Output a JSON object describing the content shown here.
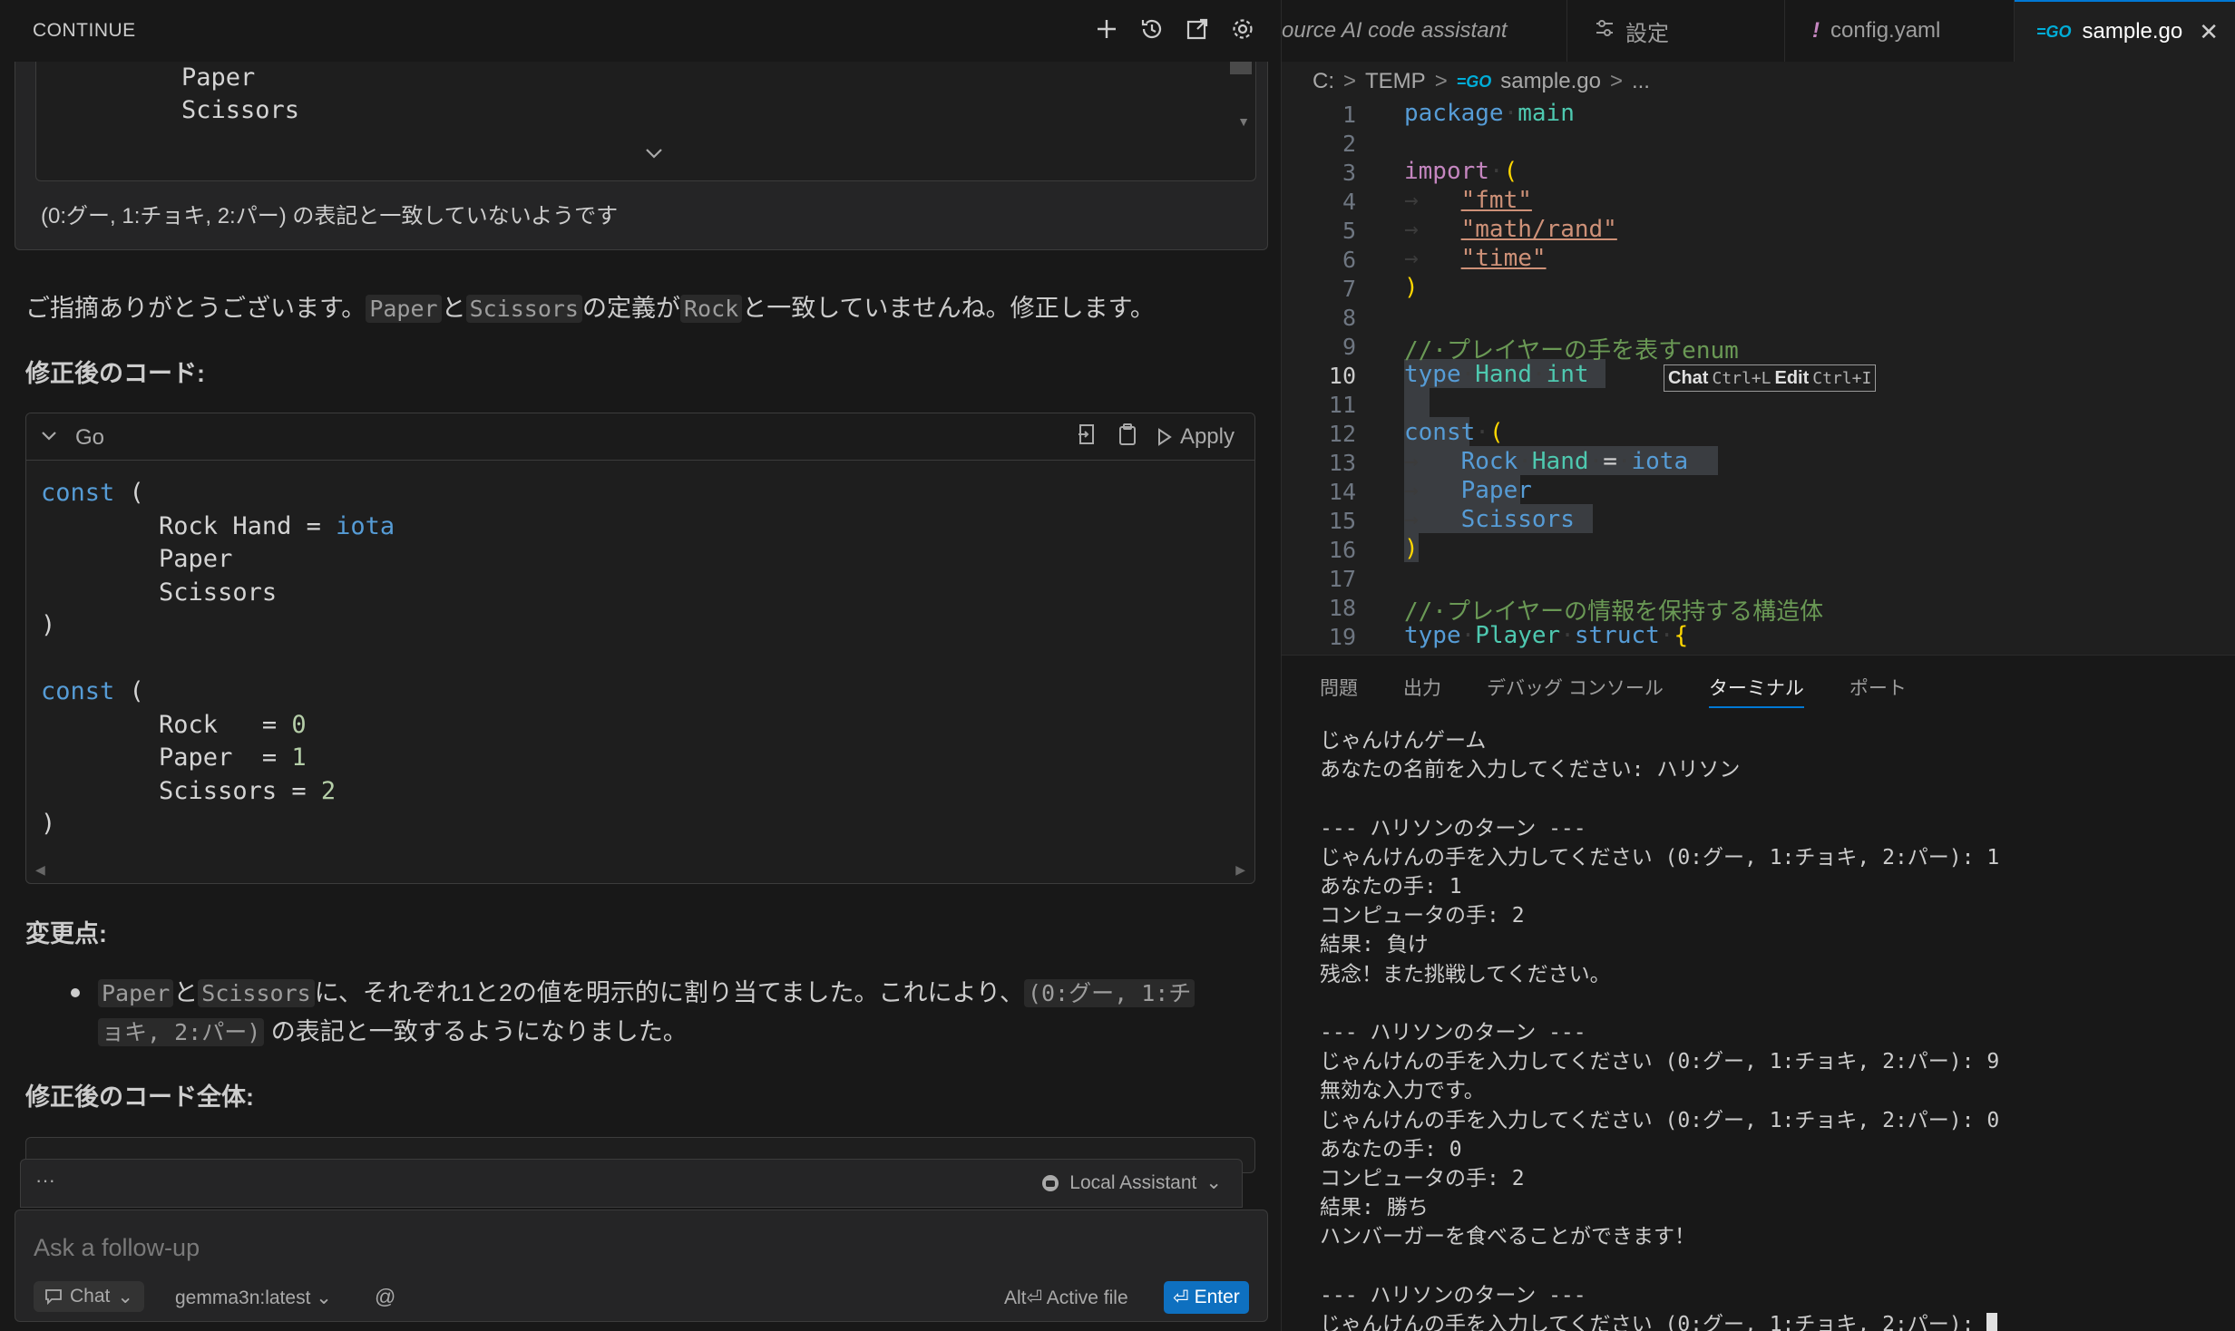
{
  "continue": {
    "title": "CONTINUE",
    "user_message": {
      "code_lines": [
        "Paper",
        "Scissors"
      ],
      "text": "(0:グー, 1:チョキ, 2:パー) の表記と一致していないようです"
    },
    "reply_intro": {
      "pre": "ご指摘ありがとうございます。",
      "code1": "Paper",
      "mid1": "と",
      "code2": "Scissors",
      "mid2": "の定義が",
      "code3": "Rock",
      "post": "と一致していませんね。修正します。"
    },
    "heading_fixed_code": "修正後のコード:",
    "code_block": {
      "language": "Go",
      "apply_label": "Apply"
    },
    "heading_changes": "変更点:",
    "bullet": {
      "code1": "Paper",
      "mid1": "と",
      "code2": "Scissors",
      "text1": "に、それぞれ1と2の値を明示的に割り当てました。これにより、",
      "code3a": "(0:グー, 1:チ",
      "code3b": "ョキ, 2:パー)",
      "text2": "の表記と一致するようになりました。"
    },
    "heading_full_code": "修正後のコード全体:",
    "status": {
      "dots": "···",
      "assistant": "Local Assistant"
    },
    "input": {
      "placeholder": "Ask a follow-up",
      "mode": "Chat",
      "model": "gemma3n:latest",
      "at": "@",
      "active_file": "Alt⏎ Active file",
      "enter": "Enter"
    }
  },
  "editor": {
    "tabs": [
      {
        "label": "ource AI code assistant",
        "icon": ""
      },
      {
        "label": "設定",
        "icon": "settings-sliders-icon"
      },
      {
        "label": "config.yaml",
        "icon": "exclamation-icon"
      },
      {
        "label": "sample.go",
        "icon": "go-icon"
      }
    ],
    "breadcrumb": {
      "drive": "C:",
      "folder": "TEMP",
      "file": "sample.go",
      "more": "..."
    },
    "hint": {
      "chat": "Chat",
      "chat_key": "Ctrl+L",
      "edit": "Edit",
      "edit_key": "Ctrl+I"
    }
  },
  "panel": {
    "tabs": [
      "問題",
      "出力",
      "デバッグ コンソール",
      "ターミナル",
      "ポート"
    ],
    "active_tab": "ターミナル",
    "terminal_lines": [
      "じゃんけんゲーム",
      "あなたの名前を入力してください: ハリソン",
      "",
      "--- ハリソンのターン ---",
      "じゃんけんの手を入力してください (0:グー, 1:チョキ, 2:パー): 1",
      "あなたの手: 1",
      "コンピュータの手: 2",
      "結果: 負け",
      "残念！また挑戦してください。",
      "",
      "--- ハリソンのターン ---",
      "じゃんけんの手を入力してください (0:グー, 1:チョキ, 2:パー): 9",
      "無効な入力です。",
      "じゃんけんの手を入力してください (0:グー, 1:チョキ, 2:パー): 0",
      "あなたの手: 0",
      "コンピュータの手: 2",
      "結果: 勝ち",
      "ハンバーガーを食べることができます！",
      "",
      "--- ハリソンのターン ---",
      "じゃんけんの手を入力してください (0:グー, 1:チョキ, 2:パー): "
    ]
  },
  "colors": {
    "accent": "#0078d4",
    "enter_button": "#0e70c0",
    "keyword": "#569cd6",
    "type": "#4ec9b0",
    "string": "#ce9178",
    "comment": "#6a9955"
  }
}
